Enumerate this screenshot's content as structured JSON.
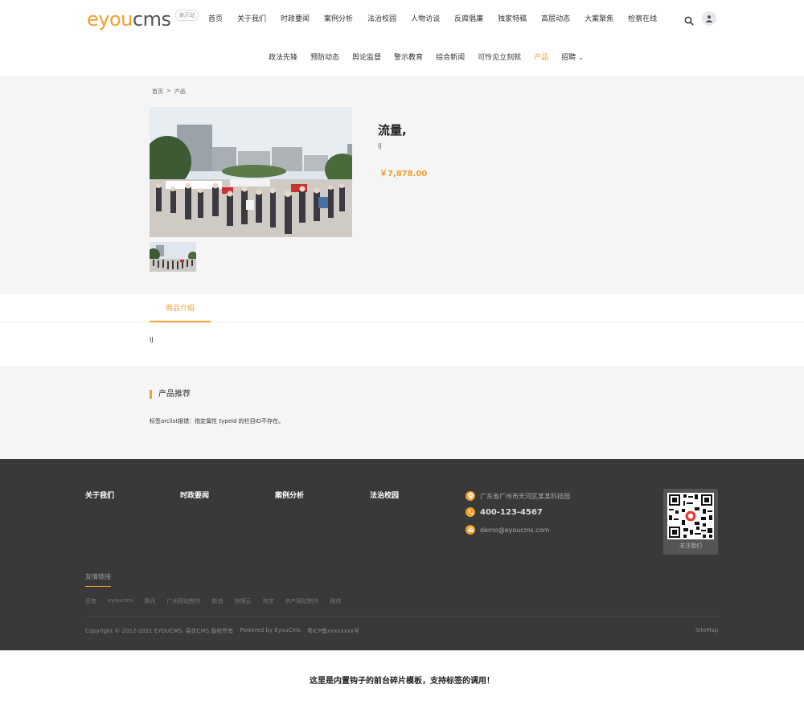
{
  "header": {
    "logo_text_e": "e",
    "logo_text_you": "you",
    "logo_text_cms": "cms",
    "logo_badge": "演示站",
    "nav_primary": [
      "首页",
      "关于我们",
      "时政要闻",
      "案例分析",
      "法治校园",
      "人物访谈",
      "反腐倡廉",
      "独家特稿",
      "高层动态",
      "大案聚焦",
      "检察在线"
    ],
    "nav_secondary": [
      "政法先锋",
      "预防动态",
      "舆论监督",
      "警示教育",
      "综合新闻",
      "可怜见立刻就",
      "产品",
      "招聘"
    ],
    "nav_secondary_active": "产品"
  },
  "breadcrumb": [
    "首页",
    "产品"
  ],
  "breadcrumb_sep": ">",
  "product": {
    "title": "流量,",
    "subtitle": "IJ",
    "price": "￥7,878.00"
  },
  "tabs": {
    "intro_label": "商品介绍",
    "intro_content": "IJ"
  },
  "recommend": {
    "title": "产品推荐",
    "message": "标签arclist报错：指定属性 typeid 的栏目ID不存在。"
  },
  "footer": {
    "columns": [
      "关于我们",
      "时政要闻",
      "案例分析",
      "法治校园"
    ],
    "address": "广东省广州市天河区某某科技园",
    "phone": "400-123-4567",
    "email": "demo@eyoucms.com",
    "qr_label": "关注我们",
    "links_title": "友情链接",
    "links": [
      "百度",
      "eyoucms",
      "腾讯",
      "广州网站制作",
      "新浪",
      "快搜云",
      "淘宝",
      "房产网站制作",
      "微信"
    ],
    "copyright": "Copyright © 2012-2021 EYOUCMS. 易优CMS 版权所有",
    "powered": "Powered by EyouCms",
    "icp": "粤ICP备xxxxxxxx号",
    "sitemap": "SiteMap"
  },
  "hook_text": "这里是内置钩子的前台碎片模板，支持标签的调用！",
  "colors": {
    "accent": "#f0a030",
    "footer_bg": "#393939",
    "section_bg": "#f5f5f5"
  }
}
